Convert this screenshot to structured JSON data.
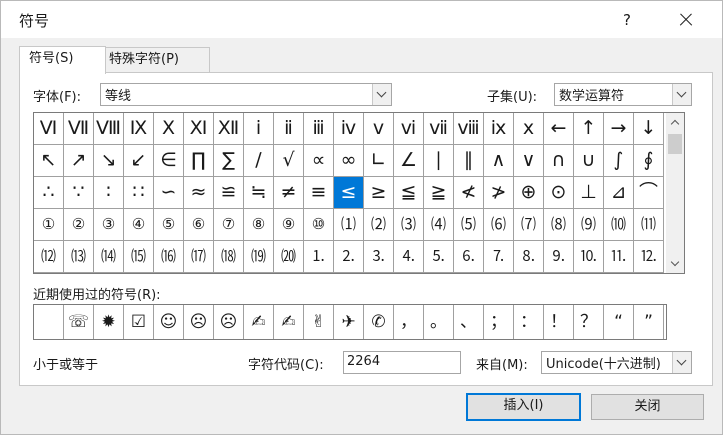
{
  "window": {
    "title": "符号",
    "help": "?"
  },
  "tabs": [
    {
      "label": "符号(S)",
      "active": true
    },
    {
      "label": "特殊字符(P)",
      "active": false
    }
  ],
  "font": {
    "label": "字体(F):",
    "value": "等线"
  },
  "subset": {
    "label": "子集(U):",
    "value": "数学运算符"
  },
  "symbols": [
    [
      "Ⅵ",
      "Ⅶ",
      "Ⅷ",
      "Ⅸ",
      "Ⅹ",
      "Ⅺ",
      "Ⅻ",
      "ⅰ",
      "ⅱ",
      "ⅲ",
      "ⅳ",
      "ⅴ",
      "ⅵ",
      "ⅶ",
      "ⅷ",
      "ⅸ",
      "ⅹ",
      "←",
      "↑",
      "→",
      "↓"
    ],
    [
      "↖",
      "↗",
      "↘",
      "↙",
      "∈",
      "∏",
      "∑",
      "∕",
      "√",
      "∝",
      "∞",
      "∟",
      "∠",
      "∣",
      "∥",
      "∧",
      "∨",
      "∩",
      "∪",
      "∫",
      "∮"
    ],
    [
      "∴",
      "∵",
      "∶",
      "∷",
      "∽",
      "≈",
      "≌",
      "≒",
      "≠",
      "≡",
      "≤",
      "≥",
      "≦",
      "≧",
      "≮",
      "≯",
      "⊕",
      "⊙",
      "⊥",
      "⊿",
      "⌒"
    ],
    [
      "①",
      "②",
      "③",
      "④",
      "⑤",
      "⑥",
      "⑦",
      "⑧",
      "⑨",
      "⑩",
      "⑴",
      "⑵",
      "⑶",
      "⑷",
      "⑸",
      "⑹",
      "⑺",
      "⑻",
      "⑼",
      "⑽",
      "⑾"
    ],
    [
      "⑿",
      "⒀",
      "⒁",
      "⒂",
      "⒃",
      "⒄",
      "⒅",
      "⒆",
      "⒇",
      "⒈",
      "⒉",
      "⒊",
      "⒋",
      "⒌",
      "⒍",
      "⒎",
      "⒏",
      "⒐",
      "⒑",
      "⒒",
      "⒓"
    ]
  ],
  "selected": {
    "row": 2,
    "col": 10
  },
  "recent": {
    "label": "近期使用过的符号(R):",
    "items": [
      "",
      "☏",
      "✹",
      "☑",
      "☺",
      "☹",
      "☹",
      "✍",
      "✍",
      "✌",
      "✈",
      "✆",
      "，",
      "。",
      "、",
      "；",
      "：",
      "！",
      "？",
      "“",
      "”"
    ]
  },
  "char_name": "小于或等于",
  "char_code": {
    "label": "字符代码(C):",
    "value": "2264"
  },
  "from": {
    "label": "来自(M):",
    "value": "Unicode(十六进制)"
  },
  "buttons": {
    "insert": "插入(I)",
    "close": "关闭"
  }
}
